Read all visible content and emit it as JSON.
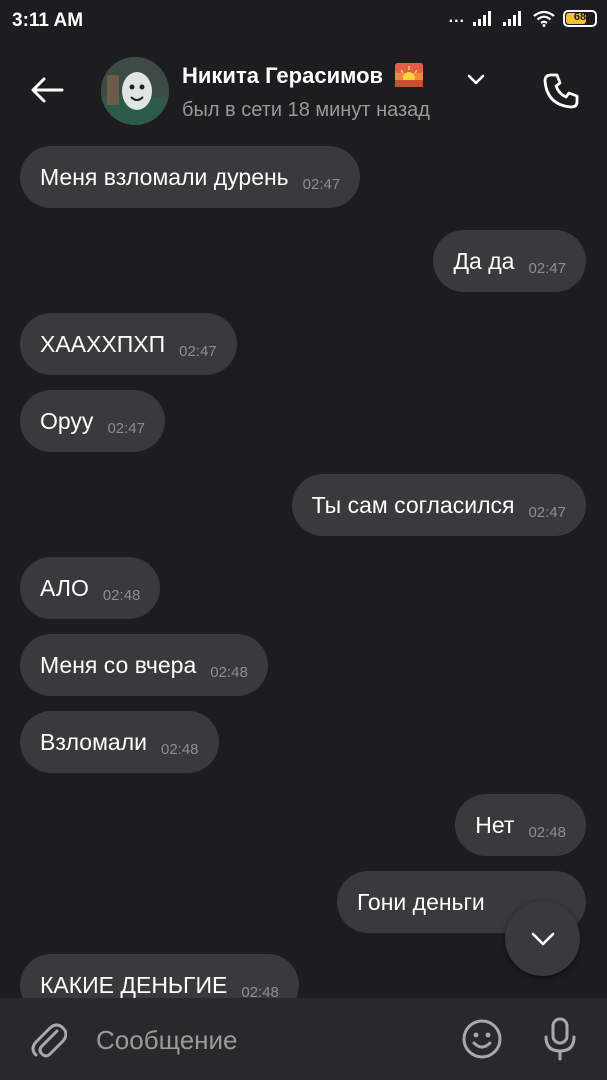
{
  "status_bar": {
    "time": "3:11 AM",
    "dots": "...",
    "battery": "68",
    "icons": [
      "signal-icon",
      "signal-icon",
      "wifi-icon",
      "battery-icon"
    ]
  },
  "header": {
    "contact_name": "Никита Герасимов",
    "status": "был в сети 18 минут назад",
    "icons": [
      "back-arrow-icon",
      "sunset-emoji-icon",
      "chevron-down-icon",
      "phone-icon"
    ]
  },
  "messages": [
    {
      "text": "Меня взломали дурень",
      "time": "02:47",
      "side": "in"
    },
    {
      "text": "Да да",
      "time": "02:47",
      "side": "out"
    },
    {
      "text": "ХААХХПХП",
      "time": "02:47",
      "side": "in"
    },
    {
      "text": "Оруу",
      "time": "02:47",
      "side": "in"
    },
    {
      "text": "Ты сам согласился",
      "time": "02:47",
      "side": "out"
    },
    {
      "text": "АЛО",
      "time": "02:48",
      "side": "in"
    },
    {
      "text": "Меня со вчера",
      "time": "02:48",
      "side": "in"
    },
    {
      "text": "Взломали",
      "time": "02:48",
      "side": "in"
    },
    {
      "text": "Нет",
      "time": "02:48",
      "side": "out"
    },
    {
      "text": "Гони деньги",
      "time": "",
      "side": "out"
    },
    {
      "text": "КАКИЕ ДЕНЬГИЕ",
      "time": "02:48",
      "side": "in"
    }
  ],
  "composer": {
    "placeholder": "Сообщение",
    "icons": [
      "paperclip-icon",
      "emoji-icon",
      "mic-icon"
    ]
  },
  "scroll_button": {
    "icon": "chevron-down-icon"
  },
  "colors": {
    "background": "#1d1d1f",
    "bubble": "#3a3a3c",
    "composer": "#29292b",
    "muted_text": "#9a9a9a",
    "battery": "#f2c230"
  }
}
